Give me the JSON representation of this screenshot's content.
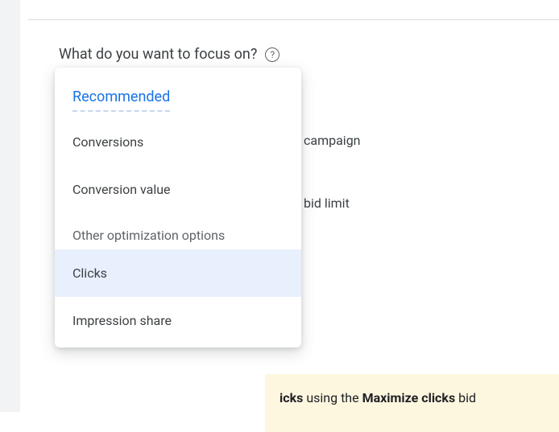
{
  "question": "What do you want to focus on?",
  "help_tooltip": "?",
  "background": {
    "line1": "campaign",
    "line2": "bid limit"
  },
  "info_strip": {
    "prefix": "icks",
    "middle": " using the ",
    "strategy": "Maximize clicks",
    "suffix": " bid "
  },
  "dropdown": {
    "recommended_header": "Recommended",
    "items_recommended": [
      "Conversions",
      "Conversion value"
    ],
    "other_header": "Other optimization options",
    "items_other": [
      "Clicks",
      "Impression share"
    ],
    "highlighted_index": 0
  }
}
